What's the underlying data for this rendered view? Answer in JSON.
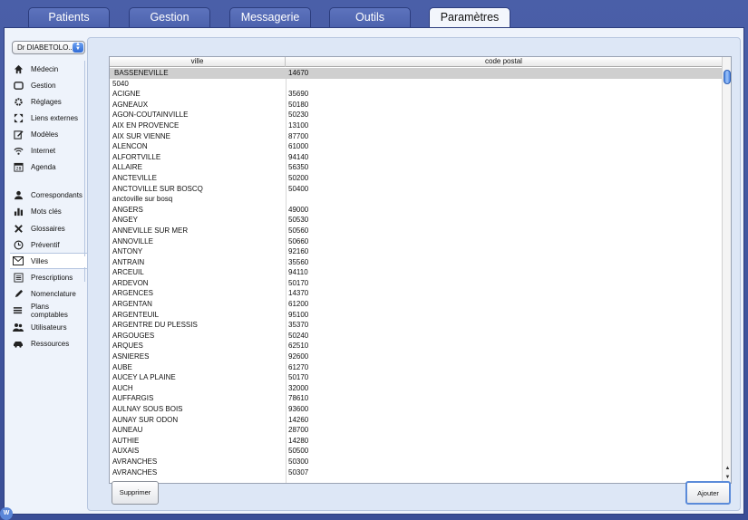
{
  "tabs": [
    {
      "label": "Patients",
      "active": false
    },
    {
      "label": "Gestion",
      "active": false
    },
    {
      "label": "Messagerie",
      "active": false
    },
    {
      "label": "Outils",
      "active": false
    },
    {
      "label": "Paramètres",
      "active": true
    }
  ],
  "doctor_select": {
    "value": "Dr DIABETOLO..."
  },
  "sidebar": {
    "items": [
      {
        "label": "Médecin",
        "icon": "house-icon"
      },
      {
        "label": "Gestion",
        "icon": "tray-icon"
      },
      {
        "label": "Réglages",
        "icon": "gear-icon"
      },
      {
        "label": "Liens externes",
        "icon": "expand-arrows-icon"
      },
      {
        "label": "Modèles",
        "icon": "edit-document-icon"
      },
      {
        "label": "Internet",
        "icon": "wifi-icon"
      },
      {
        "label": "Agenda",
        "icon": "calendar-icon"
      },
      {
        "label": "Correspondants",
        "icon": "person-icon"
      },
      {
        "label": "Mots clés",
        "icon": "bar-chart-icon"
      },
      {
        "label": "Glossaires",
        "icon": "tools-icon"
      },
      {
        "label": "Préventif",
        "icon": "clock-icon"
      },
      {
        "label": "Villes",
        "icon": "envelope-icon",
        "active": true
      },
      {
        "label": "Prescriptions",
        "icon": "list-form-icon"
      },
      {
        "label": "Nomenclature",
        "icon": "pencil-icon"
      },
      {
        "label": "Plans comptables",
        "icon": "list-icon"
      },
      {
        "label": "Utilisateurs",
        "icon": "users-icon"
      },
      {
        "label": "Ressources",
        "icon": "car-icon"
      }
    ]
  },
  "table": {
    "columns": [
      "ville",
      "code postal"
    ],
    "rows": [
      [
        "BASSENEVILLE",
        "14670"
      ],
      [
        "5040",
        ""
      ],
      [
        "ACIGNE",
        "35690"
      ],
      [
        "AGNEAUX",
        "50180"
      ],
      [
        "AGON-COUTAINVILLE",
        "50230"
      ],
      [
        "AIX EN PROVENCE",
        "13100"
      ],
      [
        "AIX SUR VIENNE",
        "87700"
      ],
      [
        "ALENCON",
        "61000"
      ],
      [
        "ALFORTVILLE",
        "94140"
      ],
      [
        "ALLAIRE",
        "56350"
      ],
      [
        "ANCTEVILLE",
        "50200"
      ],
      [
        "ANCTOVILLE SUR BOSCQ",
        "50400"
      ],
      [
        "anctoville sur bosq",
        ""
      ],
      [
        "ANGERS",
        "49000"
      ],
      [
        "ANGEY",
        "50530"
      ],
      [
        "ANNEVILLE SUR MER",
        "50560"
      ],
      [
        "ANNOVILLE",
        "50660"
      ],
      [
        "ANTONY",
        "92160"
      ],
      [
        "ANTRAIN",
        "35560"
      ],
      [
        "ARCEUIL",
        "94110"
      ],
      [
        "ARDEVON",
        "50170"
      ],
      [
        "ARGENCES",
        "14370"
      ],
      [
        "ARGENTAN",
        "61200"
      ],
      [
        "ARGENTEUIL",
        "95100"
      ],
      [
        "ARGENTRE DU PLESSIS",
        "35370"
      ],
      [
        "ARGOUGES",
        "50240"
      ],
      [
        "ARQUES",
        "62510"
      ],
      [
        "ASNIERES",
        "92600"
      ],
      [
        "AUBE",
        "61270"
      ],
      [
        "AUCEY LA PLAINE",
        "50170"
      ],
      [
        "AUCH",
        "32000"
      ],
      [
        "AUFFARGIS",
        "78610"
      ],
      [
        "AULNAY SOUS BOIS",
        "93600"
      ],
      [
        "AUNAY SUR ODON",
        "14260"
      ],
      [
        "AUNEAU",
        "28700"
      ],
      [
        "AUTHIE",
        "14280"
      ],
      [
        "AUXAIS",
        "50500"
      ],
      [
        "AVRANCHES",
        "50300"
      ],
      [
        "AVRANCHES",
        "50307"
      ]
    ],
    "selected_row": 0
  },
  "buttons": {
    "delete": "Supprimer",
    "add": "Ajouter"
  },
  "colors": {
    "accent": "#4a5fa8",
    "selection": "#cfcfcf"
  }
}
